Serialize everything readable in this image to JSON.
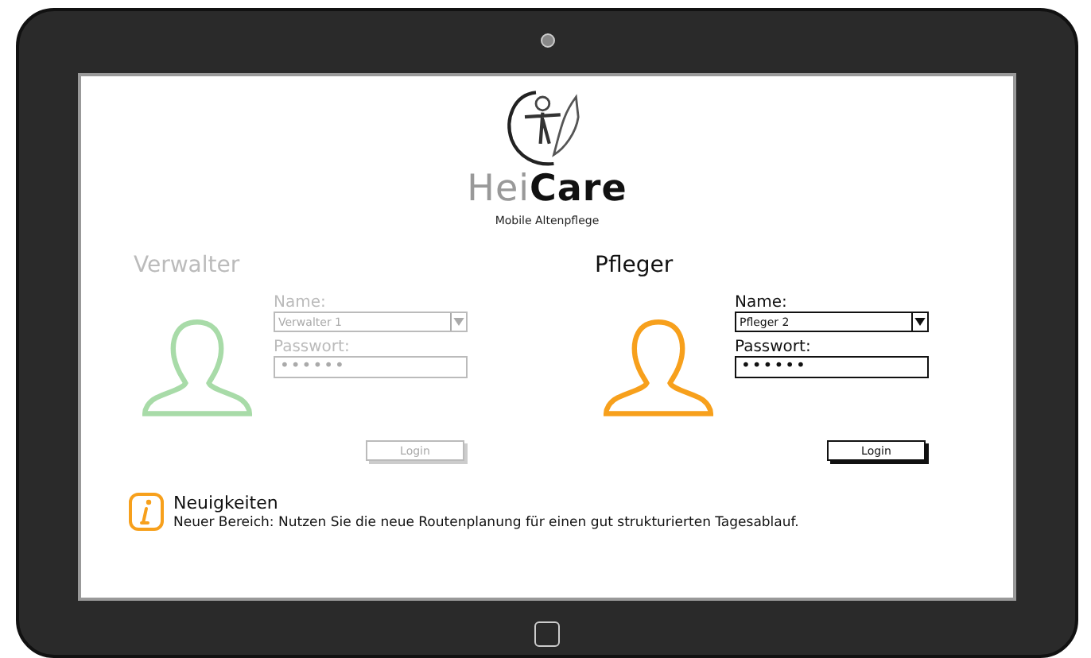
{
  "logo": {
    "name": "Hei**Care**",
    "tagline": "Mobile Altenpflege"
  },
  "panels": [
    {
      "title": "Verwalter",
      "disabled": true,
      "color": "#a8dba8",
      "name_label": "Name:",
      "name_value": "Verwalter 1",
      "password_label": "Passwort:",
      "password_value": "••••••",
      "button": "Login"
    },
    {
      "title": "Pfleger",
      "disabled": false,
      "color": "#f7a01c",
      "name_label": "Name:",
      "name_value": "Pfleger 2",
      "password_label": "Passwort:",
      "password_value": "••••••",
      "button": "Login"
    }
  ],
  "news": {
    "title": "Neuigkeiten",
    "text": "Neuer Bereich: Nutzen Sie die neue Routenplanung für einen gut strukturierten Tagesablauf."
  }
}
